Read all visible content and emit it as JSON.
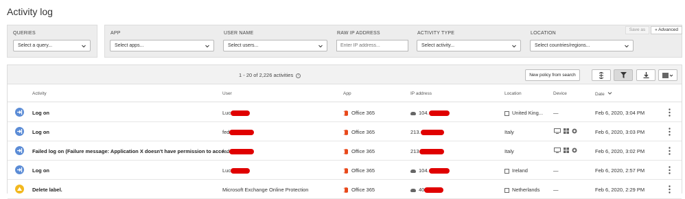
{
  "page": {
    "title": "Activity log"
  },
  "filters": {
    "queries": {
      "label": "QUERIES",
      "value": "Select a query..."
    },
    "app": {
      "label": "APP",
      "value": "Select apps..."
    },
    "username": {
      "label": "USER NAME",
      "value": "Select users..."
    },
    "ip": {
      "label": "RAW IP ADDRESS",
      "placeholder": "Enter IP address..."
    },
    "activity_type": {
      "label": "ACTIVITY TYPE",
      "value": "Select activity..."
    },
    "location": {
      "label": "LOCATION",
      "value": "Select countries/regions..."
    },
    "save_as": "Save as",
    "advanced": "Advanced"
  },
  "toolbar": {
    "count": "1 - 20 of 2,226 activities",
    "new_policy": "New policy from search"
  },
  "columns": {
    "activity": "Activity",
    "user": "User",
    "app": "App",
    "ip": "IP address",
    "location": "Location",
    "device": "Device",
    "date": "Date"
  },
  "rows": [
    {
      "activity": "Log on",
      "user": "Luc",
      "app": "Office 365",
      "ip": "104.",
      "location": "United King...",
      "device": "—",
      "date": "Feb 6, 2020, 3:04 PM",
      "icon": "logon"
    },
    {
      "activity": "Log on",
      "user": "fed",
      "app": "Office 365",
      "ip": "213.",
      "location": "Italy",
      "device": "icons",
      "date": "Feb 6, 2020, 3:03 PM",
      "icon": "logon"
    },
    {
      "activity": "Failed log on (Failure message: Application X doesn't have permission to acce...",
      "user": "fed",
      "app": "Office 365",
      "ip": "213",
      "location": "Italy",
      "device": "icons",
      "date": "Feb 6, 2020, 3:02 PM",
      "icon": "logon"
    },
    {
      "activity": "Log on",
      "user": "Luc",
      "app": "Office 365",
      "ip": "104.",
      "location": "Ireland",
      "device": "—",
      "date": "Feb 6, 2020, 2:57 PM",
      "icon": "logon"
    },
    {
      "activity": "Delete label.",
      "user": "Microsoft Exchange Online Protection",
      "app": "Office 365",
      "ip": "40",
      "location": "Netherlands",
      "device": "—",
      "date": "Feb 6, 2020, 2:29 PM",
      "icon": "label"
    }
  ],
  "colors": {
    "accent_blue": "#5b8cd6",
    "redaction": "#e00000",
    "office": "#e8481a",
    "label_yellow": "#f2b81f"
  }
}
